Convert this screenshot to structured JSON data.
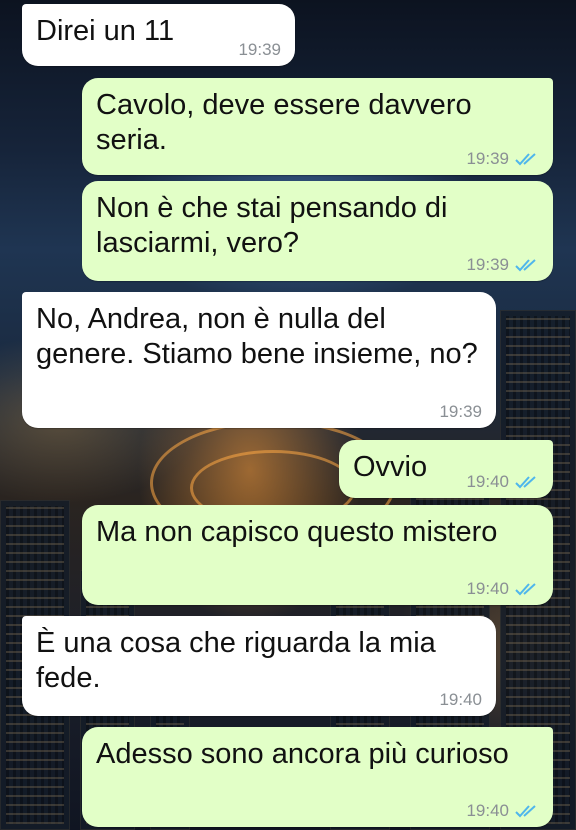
{
  "messages": [
    {
      "direction": "in",
      "text": "Direi un 11",
      "time": "19:39"
    },
    {
      "direction": "out",
      "text": "Cavolo, deve essere davvero seria.",
      "time": "19:39",
      "status": "read"
    },
    {
      "direction": "out",
      "text": "Non è che stai pensando di lasciarmi, vero?",
      "time": "19:39",
      "status": "read"
    },
    {
      "direction": "in",
      "text": "No, Andrea, non è nulla del genere. Stiamo bene insieme, no?",
      "time": "19:39"
    },
    {
      "direction": "out",
      "text": "Ovvio",
      "time": "19:40",
      "status": "read"
    },
    {
      "direction": "out",
      "text": "Ma non capisco questo mistero",
      "time": "19:40",
      "status": "read"
    },
    {
      "direction": "in",
      "text": "È una cosa che riguarda la mia fede.",
      "time": "19:40"
    },
    {
      "direction": "out",
      "text": "Adesso sono ancora più curioso",
      "time": "19:40",
      "status": "read"
    }
  ],
  "colors": {
    "incoming_bubble": "#ffffff",
    "outgoing_bubble": "#e2ffc7",
    "read_ticks": "#4fb6ec",
    "timestamp": "#8a8f94"
  },
  "icons": {
    "read_status": "double-check-icon"
  }
}
